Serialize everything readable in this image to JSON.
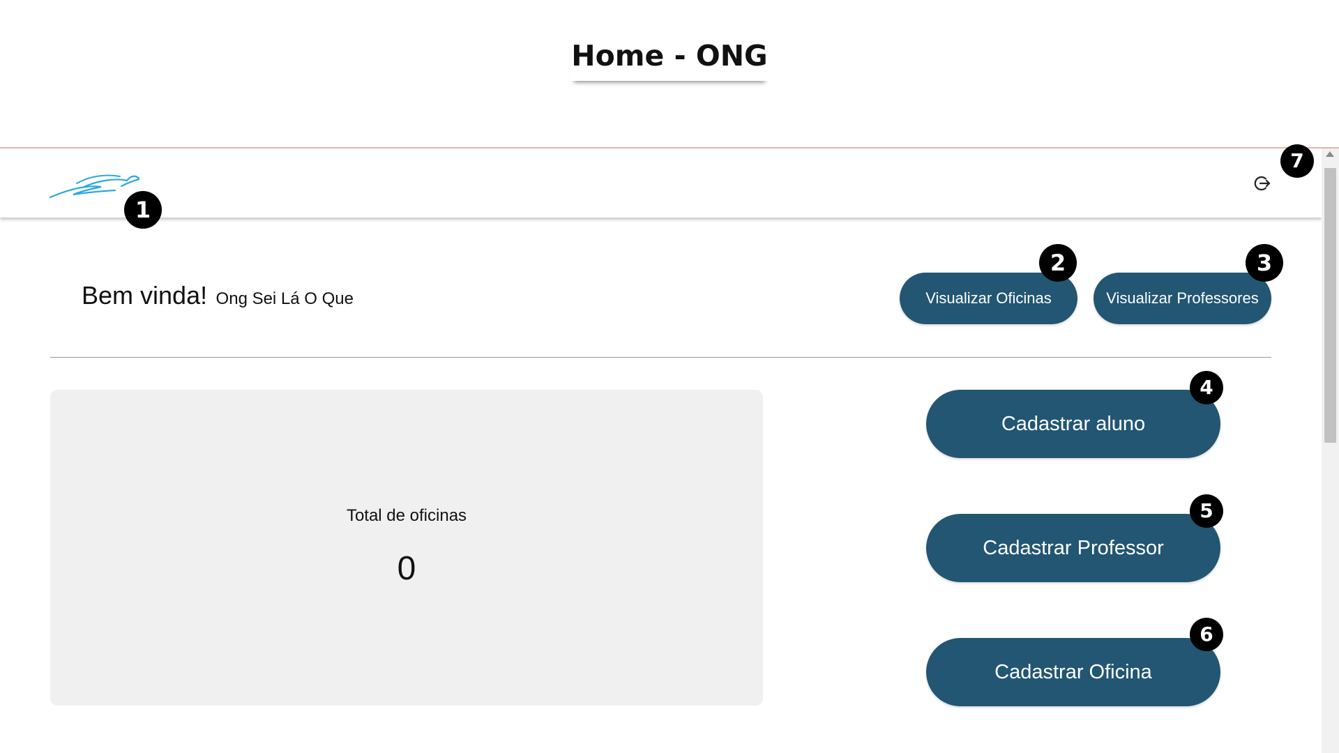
{
  "page": {
    "title": "Home - ONG"
  },
  "navbar": {
    "logo_icon": "bird-logo-icon",
    "logout_icon": "logout-icon"
  },
  "welcome": {
    "greeting": "Bem vinda!",
    "org_name": "Ong Sei Lá O Que"
  },
  "actions": {
    "view_workshops": "Visualizar Oficinas",
    "view_teachers": "Visualizar Professores",
    "register_student": "Cadastrar aluno",
    "register_teacher": "Cadastrar Professor",
    "register_workshop": "Cadastrar Oficina"
  },
  "stats": {
    "total_label": "Total de oficinas",
    "total_value": "0"
  },
  "markers": [
    "1",
    "2",
    "3",
    "4",
    "5",
    "6",
    "7"
  ],
  "colors": {
    "button": "#225673",
    "card": "#f0f0f0",
    "logo": "#2aa8df",
    "header_rule": "#e8b4a8"
  }
}
